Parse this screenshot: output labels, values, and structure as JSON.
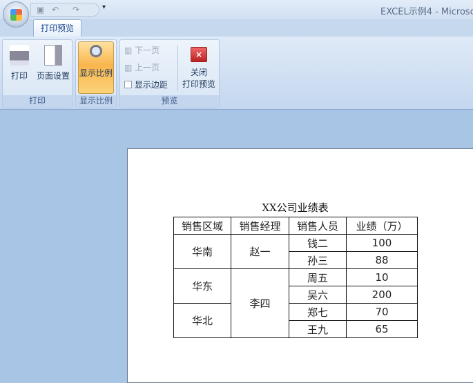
{
  "window": {
    "title": "EXCEL示例4 - Microso"
  },
  "qat": {
    "save": "save-icon",
    "undo": "undo-icon",
    "redo": "redo-icon",
    "more": "▾"
  },
  "tabs": [
    {
      "label": "打印预览"
    }
  ],
  "ribbon": {
    "print_group": {
      "label": "打印",
      "print": "打印",
      "page_setup": "页面设置"
    },
    "zoom_group": {
      "label": "显示比例",
      "zoom": "显示比例"
    },
    "preview_group": {
      "label": "预览",
      "next_page": "下一页",
      "prev_page": "上一页",
      "show_margins": "显示边距",
      "show_margins_checked": false,
      "close_line1": "关闭",
      "close_line2": "打印预览"
    }
  },
  "sheet": {
    "title": "XX公司业绩表",
    "headers": [
      "销售区域",
      "销售经理",
      "销售人员",
      "业绩（万）"
    ],
    "regions": [
      "华南",
      "华东",
      "华北"
    ],
    "managers": [
      "赵一",
      "李四"
    ],
    "rows": [
      [
        "钱二",
        "100"
      ],
      [
        "孙三",
        "88"
      ],
      [
        "周五",
        "10"
      ],
      [
        "吴六",
        "200"
      ],
      [
        "郑七",
        "70"
      ],
      [
        "王九",
        "65"
      ]
    ]
  }
}
